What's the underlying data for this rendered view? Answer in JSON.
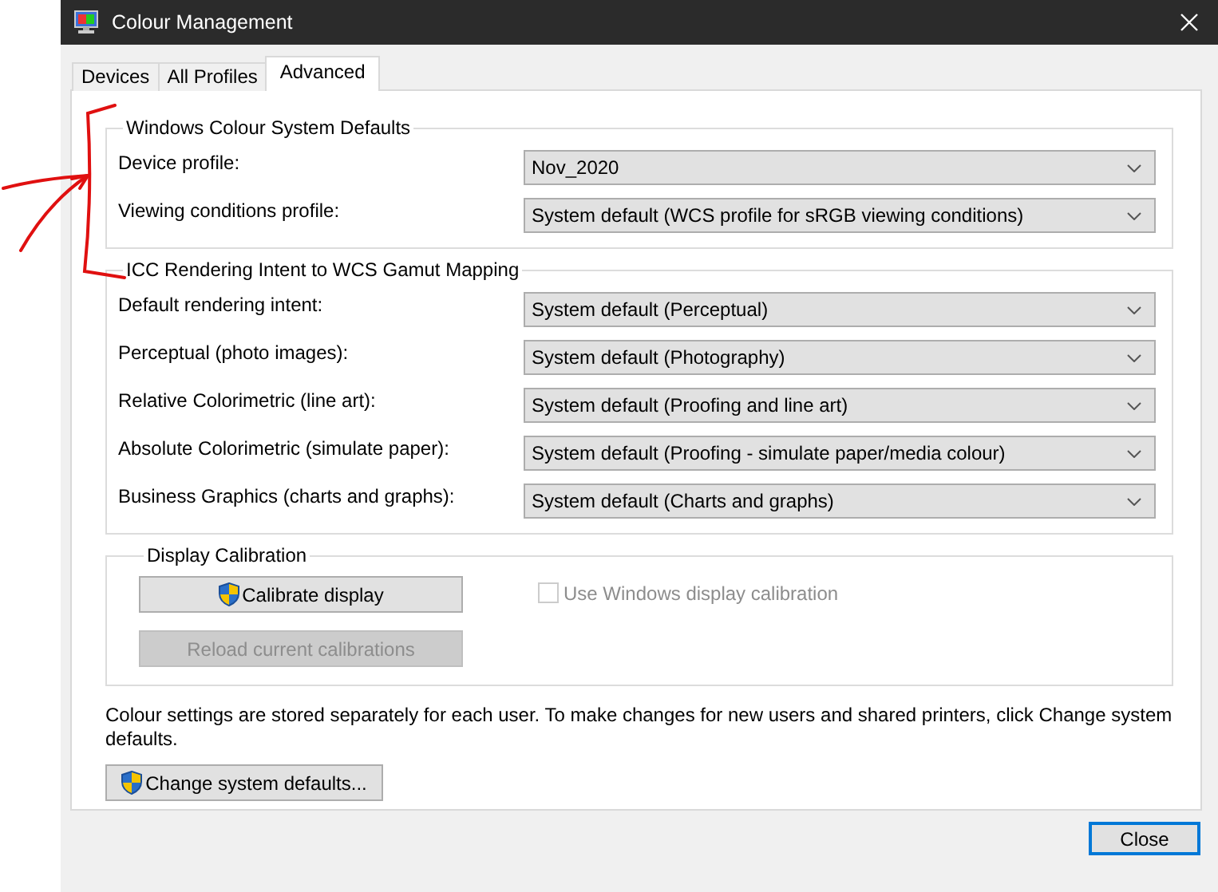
{
  "window": {
    "title": "Colour Management"
  },
  "tabs": [
    {
      "label": "Devices",
      "selected": false
    },
    {
      "label": "All Profiles",
      "selected": false
    },
    {
      "label": "Advanced",
      "selected": true
    }
  ],
  "groups": [
    {
      "title": "Windows Colour System Defaults",
      "rows": [
        {
          "label": "Device profile:",
          "value": "Nov_2020"
        },
        {
          "label": "Viewing conditions profile:",
          "value": "System default (WCS profile for sRGB viewing conditions)"
        }
      ]
    },
    {
      "title": "ICC Rendering Intent to WCS Gamut Mapping",
      "rows": [
        {
          "label": "Default rendering intent:",
          "value": "System default (Perceptual)"
        },
        {
          "label": "Perceptual (photo images):",
          "value": "System default (Photography)"
        },
        {
          "label": "Relative Colorimetric (line art):",
          "value": "System default (Proofing and line art)"
        },
        {
          "label": "Absolute Colorimetric (simulate paper):",
          "value": "System default (Proofing - simulate paper/media colour)"
        },
        {
          "label": "Business Graphics (charts and graphs):",
          "value": "System default (Charts and graphs)"
        }
      ]
    }
  ],
  "calibration": {
    "title": "Display Calibration",
    "buttons": [
      {
        "label": "Calibrate display",
        "shield": true,
        "disabled": false
      },
      {
        "label": "Reload current calibrations",
        "shield": false,
        "disabled": true
      }
    ],
    "checkbox": {
      "label": "Use Windows display calibration",
      "checked": false,
      "disabled": true
    }
  },
  "note": "Colour settings are stored separately for each user. To make changes for new users and shared printers, click Change system defaults.",
  "system_button": {
    "label": "Change system defaults...",
    "shield": true,
    "disabled": false
  },
  "close_button": {
    "label": "Close",
    "default": true
  }
}
